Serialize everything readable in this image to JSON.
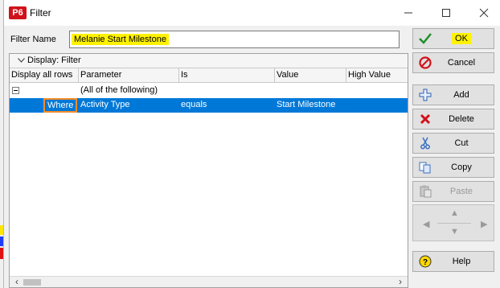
{
  "window": {
    "app_logo": "P6",
    "title": "Filter"
  },
  "filter_name": {
    "label": "Filter Name",
    "value": "Melanie Start Milestone"
  },
  "display_bar": {
    "label": "Display: Filter"
  },
  "columns": [
    "Display all rows",
    "Parameter",
    "Is",
    "Value",
    "High Value"
  ],
  "rows": [
    {
      "condition": "",
      "parameter": "(All of the following)",
      "is": "",
      "value": "",
      "high_value": ""
    },
    {
      "condition": "Where",
      "parameter": "Activity Type",
      "is": "equals",
      "value": "Start Milestone",
      "high_value": ""
    }
  ],
  "buttons": {
    "ok": "OK",
    "cancel": "Cancel",
    "add": "Add",
    "delete": "Delete",
    "cut": "Cut",
    "copy": "Copy",
    "paste": "Paste",
    "help": "Help"
  },
  "colors": {
    "selection": "#0078d7",
    "highlight": "#fff200",
    "accent_orange": "#f28c28",
    "logo_red": "#d0121b"
  }
}
